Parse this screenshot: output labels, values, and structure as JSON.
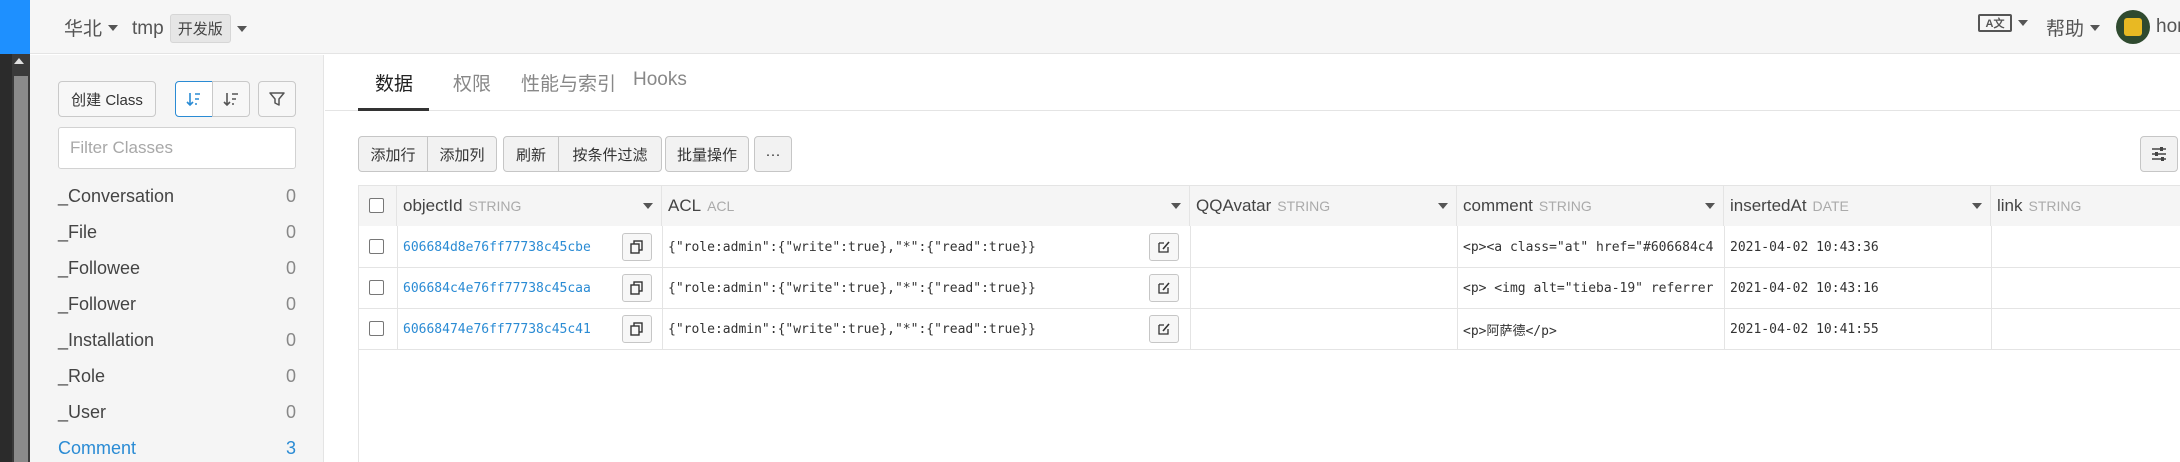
{
  "topbar": {
    "region": "华北",
    "app_name": "tmp",
    "app_badge": "开发版",
    "lang_icon_label": "A文",
    "help": "帮助",
    "user": "hor"
  },
  "sidebar": {
    "create_class": "创建 Class",
    "filter_placeholder": "Filter Classes",
    "classes": [
      {
        "name": "_Conversation",
        "count": "0"
      },
      {
        "name": "_File",
        "count": "0"
      },
      {
        "name": "_Followee",
        "count": "0"
      },
      {
        "name": "_Follower",
        "count": "0"
      },
      {
        "name": "_Installation",
        "count": "0"
      },
      {
        "name": "_Role",
        "count": "0"
      },
      {
        "name": "_User",
        "count": "0"
      },
      {
        "name": "Comment",
        "count": "3"
      }
    ]
  },
  "tabs": [
    "数据",
    "权限",
    "性能与索引",
    "Hooks"
  ],
  "toolbar": {
    "add_row": "添加行",
    "add_column": "添加列",
    "refresh": "刷新",
    "filter": "按条件过滤",
    "batch": "批量操作",
    "more": "···"
  },
  "columns": [
    {
      "name": "objectId",
      "type": "STRING"
    },
    {
      "name": "ACL",
      "type": "ACL"
    },
    {
      "name": "QQAvatar",
      "type": "STRING"
    },
    {
      "name": "comment",
      "type": "STRING"
    },
    {
      "name": "insertedAt",
      "type": "DATE"
    },
    {
      "name": "link",
      "type": "STRING"
    }
  ],
  "rows": [
    {
      "objectId": "606684d8e76ff77738c45cbe",
      "acl": "{\"role:admin\":{\"write\":true},\"*\":{\"read\":true}}",
      "qqavatar": "",
      "comment": "<p><a class=\"at\" href=\"#606684c4",
      "insertedAt": "2021-04-02 10:43:36",
      "link": ""
    },
    {
      "objectId": "606684c4e76ff77738c45caa",
      "acl": "{\"role:admin\":{\"write\":true},\"*\":{\"read\":true}}",
      "qqavatar": "",
      "comment": "<p> <img alt=\"tieba-19\" referrer",
      "insertedAt": "2021-04-02 10:43:16",
      "link": ""
    },
    {
      "objectId": "60668474e76ff77738c45c41",
      "acl": "{\"role:admin\":{\"write\":true},\"*\":{\"read\":true}}",
      "qqavatar": "",
      "comment": "<p>阿萨德</p>",
      "insertedAt": "2021-04-02 10:41:55",
      "link": ""
    }
  ],
  "colors": {
    "accent": "#2a8bd4",
    "topbar_blue": "#1e90ff"
  }
}
